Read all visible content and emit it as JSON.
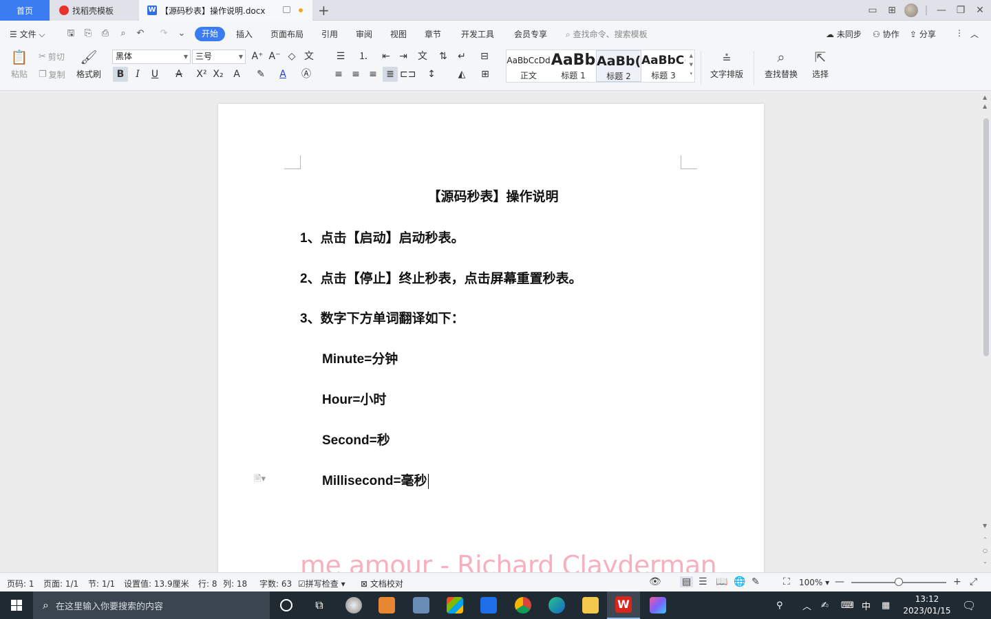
{
  "tabs": {
    "home": "首页",
    "template": "找稻壳模板",
    "doc": "【源码秒表】操作说明.docx"
  },
  "menu": {
    "file": "文件",
    "items": [
      "开始",
      "插入",
      "页面布局",
      "引用",
      "审阅",
      "视图",
      "章节",
      "开发工具",
      "会员专享"
    ],
    "search_placeholder": "查找命令、搜索模板",
    "sync": "未同步",
    "collab": "协作",
    "share": "分享"
  },
  "ribbon": {
    "paste": "粘贴",
    "cut": "剪切",
    "copy": "复制",
    "format_painter": "格式刷",
    "font_name": "黑体",
    "font_size": "三号",
    "styles": [
      {
        "sample": "AaBbCcDd",
        "name": "正文"
      },
      {
        "sample": "AaBb",
        "name": "标题 1"
      },
      {
        "sample": "AaBb(",
        "name": "标题 2"
      },
      {
        "sample": "AaBbC(",
        "name": "标题 3"
      }
    ],
    "text_layout": "文字排版",
    "find_replace": "查找替换",
    "select": "选择"
  },
  "document": {
    "title": "【源码秒表】操作说明",
    "lines": [
      "1、点击【启动】启动秒表。",
      "2、点击【停止】终止秒表，点击屏幕重置秒表。",
      "3、数字下方单词翻译如下：",
      "Minute=分钟",
      "Hour=小时",
      "Second=秒",
      "Millisecond=毫秒"
    ]
  },
  "overlay_text": "me amour - Richard Clayderman",
  "status": {
    "page_no": "页码: 1",
    "pages": "页面: 1/1",
    "section": "节: 1/1",
    "setting": "设置值: 13.9厘米",
    "row": "行: 8",
    "col": "列: 18",
    "word_count": "字数: 63",
    "spell_check": "拼写检查",
    "doc_check": "文档校对",
    "zoom": "100%"
  },
  "taskbar": {
    "search_placeholder": "在这里输入你要搜索的内容",
    "ime": "中",
    "time": "13:12",
    "date": "2023/01/15"
  },
  "colors": {
    "accent": "#3b7cf1",
    "taskbar": "#1f2a33",
    "overlay": "#f7a9b8"
  }
}
